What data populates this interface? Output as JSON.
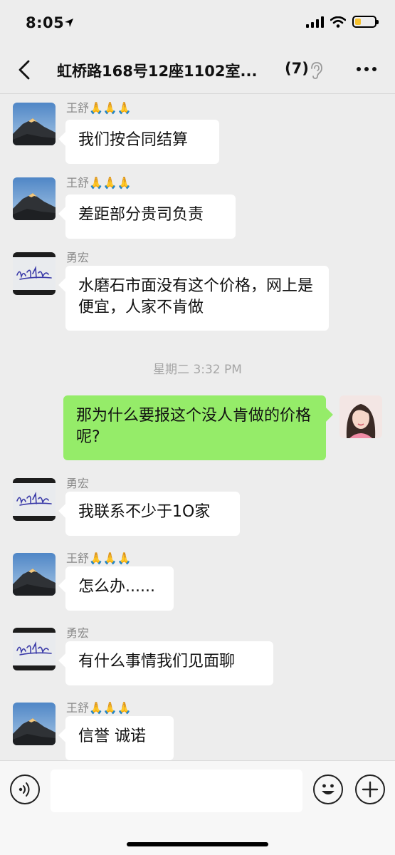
{
  "status": {
    "time": "8:05",
    "battery_fill_fraction": 0.3,
    "battery_color": "#f5c12e"
  },
  "nav": {
    "title": "虹桥路168号12座1102室...",
    "member_count": "(7)",
    "icons": {
      "back": "chevron-left-icon",
      "mute": "ear-icon",
      "more": "more-icon"
    }
  },
  "messages": [
    {
      "type": "msg",
      "side": "left",
      "sender": "王舒🙏🙏🙏",
      "avatar": "mountain-avatar",
      "text": "我们按合同结算"
    },
    {
      "type": "msg",
      "side": "left",
      "sender": "王舒🙏🙏🙏",
      "avatar": "mountain-avatar",
      "text": "差距部分贵司负责"
    },
    {
      "type": "msg",
      "side": "left",
      "sender": "勇宏",
      "avatar": "signature-avatar",
      "text": "水磨石市面没有这个价格，网上是便宜，人家不肯做"
    },
    {
      "type": "time",
      "text": "星期二 3:32 PM"
    },
    {
      "type": "msg",
      "side": "right",
      "avatar": "girl-avatar",
      "text": "那为什么要报这个没人肯做的价格呢?"
    },
    {
      "type": "msg",
      "side": "left",
      "sender": "勇宏",
      "avatar": "signature-avatar",
      "text": "我联系不少于1O家"
    },
    {
      "type": "msg",
      "side": "left",
      "sender": "王舒🙏🙏🙏",
      "avatar": "mountain-avatar",
      "text": "怎么办......"
    },
    {
      "type": "msg",
      "side": "left",
      "sender": "勇宏",
      "avatar": "signature-avatar",
      "text": "有什么事情我们见面聊"
    },
    {
      "type": "msg",
      "side": "left",
      "sender": "王舒🙏🙏🙏",
      "avatar": "mountain-avatar",
      "text": "信誉  诚诺"
    }
  ],
  "input_bar": {
    "text_value": "",
    "icons": {
      "voice": "voice-icon",
      "emoji": "emoji-icon",
      "add": "plus-icon"
    }
  },
  "colors": {
    "background": "#ededed",
    "my_bubble": "#95ec69",
    "their_bubble": "#ffffff"
  }
}
